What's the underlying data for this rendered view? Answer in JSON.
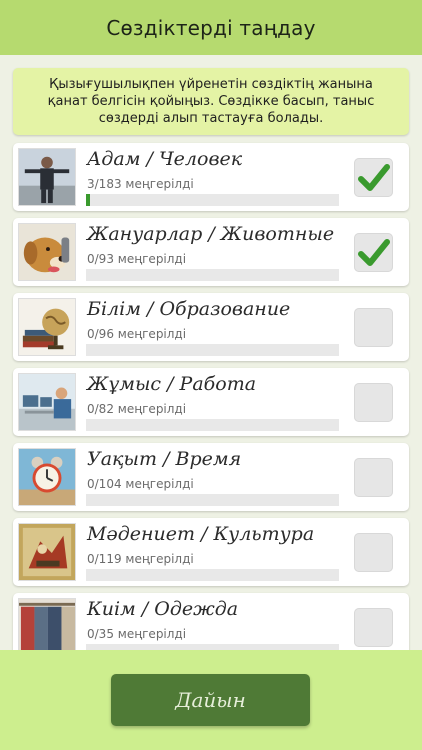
{
  "header": {
    "title": "Сөздіктерді таңдау"
  },
  "notice": {
    "text": "Қызығушылықпен үйренетін сөздіктің жанына қанат белгісін қойыңыз. Сөздікке басып, таныс сөздерді алып тастауға болады."
  },
  "colors": {
    "accent": "#b6da6f",
    "progress": "#3a9a2e",
    "check": "#3a9a2e",
    "button": "#4f7a36"
  },
  "categories": [
    {
      "title": "Адам / Человек",
      "status": "3/183 меңгерілді",
      "progress": 0.016,
      "checked": true,
      "icon": "person-photo"
    },
    {
      "title": "Жануарлар / Животные",
      "status": "0/93 меңгерілді",
      "progress": 0,
      "checked": true,
      "icon": "dog-photo"
    },
    {
      "title": "Білім / Образование",
      "status": "0/96 меңгерілді",
      "progress": 0,
      "checked": false,
      "icon": "globe-books-photo"
    },
    {
      "title": "Жұмыс / Работа",
      "status": "0/82 меңгерілді",
      "progress": 0,
      "checked": false,
      "icon": "office-photo"
    },
    {
      "title": "Уақыт / Время",
      "status": "0/104 меңгерілді",
      "progress": 0,
      "checked": false,
      "icon": "alarm-clock-photo"
    },
    {
      "title": "Мәдениет / Культура",
      "status": "0/119 меңгерілді",
      "progress": 0,
      "checked": false,
      "icon": "painting-photo"
    },
    {
      "title": "Киім / Одежда",
      "status": "0/35 меңгерілді",
      "progress": 0,
      "checked": false,
      "icon": "clothes-photo"
    }
  ],
  "footer": {
    "done_label": "Дайын"
  }
}
